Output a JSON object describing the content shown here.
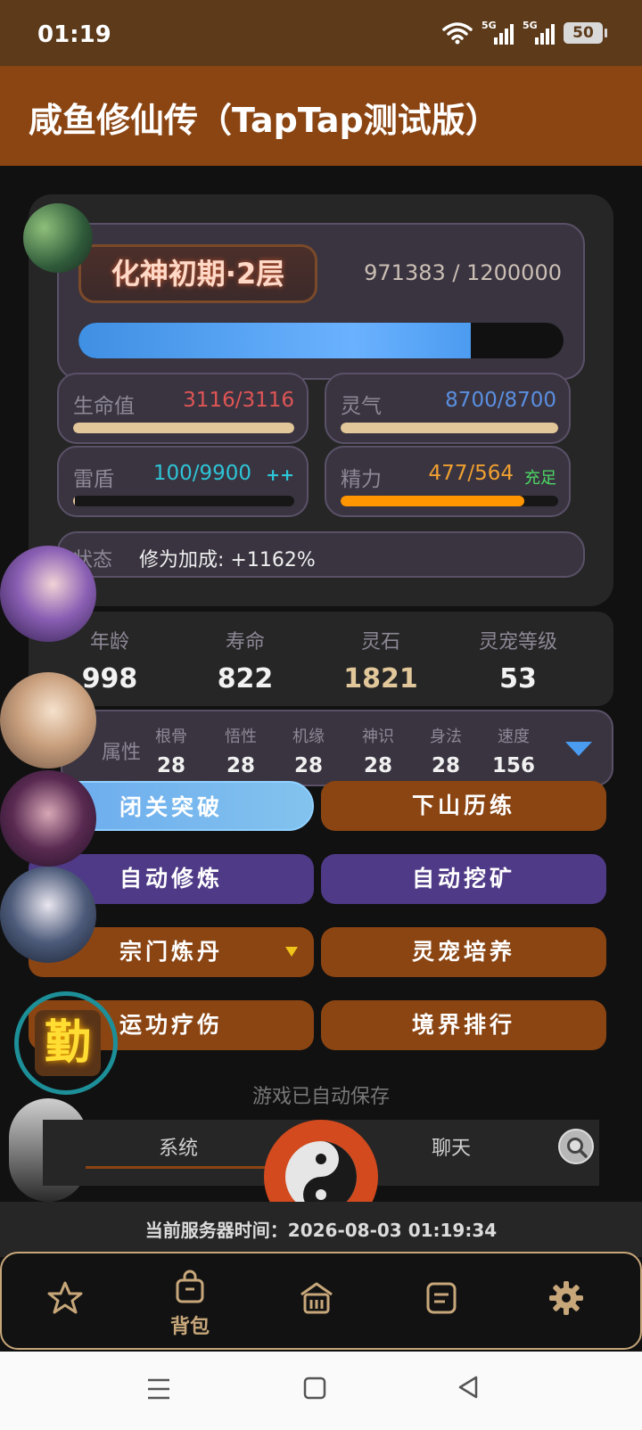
{
  "status_bar": {
    "time": "01:19",
    "signal1": "5G",
    "signal2": "5G",
    "battery": "50"
  },
  "title": "咸鱼修仙传（TapTap测试版）",
  "realm": {
    "name": "化神初期·2层",
    "xp_text": "971383 / 1200000",
    "xp_current": 971383,
    "xp_max": 1200000
  },
  "stats": {
    "hp": {
      "label": "生命值",
      "value": "3116/3116",
      "fraction": 1.0,
      "color": "#e05555"
    },
    "spirit": {
      "label": "灵气",
      "value": "8700/8700",
      "fraction": 1.0,
      "color": "#5a8fe0"
    },
    "shield": {
      "label": "雷盾",
      "value": "100/9900",
      "extra": "++",
      "fraction": 0.01,
      "color": "#2ec4d6"
    },
    "energy": {
      "label": "精力",
      "value": "477/564",
      "extra": "充足",
      "fraction": 0.845,
      "color": "#f0a030",
      "extra_color": "#4cd964"
    }
  },
  "state": {
    "label": "状态",
    "value": "修为加成: +1162%"
  },
  "info": [
    {
      "label": "年龄",
      "value": "998"
    },
    {
      "label": "寿命",
      "value": "822"
    },
    {
      "label": "灵石",
      "value": "1821"
    },
    {
      "label": "灵宠等级",
      "value": "53"
    }
  ],
  "attributes": {
    "title": "属性",
    "items": [
      {
        "label": "根骨",
        "value": "28"
      },
      {
        "label": "悟性",
        "value": "28"
      },
      {
        "label": "机缘",
        "value": "28"
      },
      {
        "label": "神识",
        "value": "28"
      },
      {
        "label": "身法",
        "value": "28"
      },
      {
        "label": "速度",
        "value": "156"
      }
    ]
  },
  "buttons": {
    "breakthrough": "闭关突破",
    "adventure": "下山历练",
    "auto_cultivate": "自动修炼",
    "auto_mine": "自动挖矿",
    "alchemy": "宗门炼丹",
    "pet_training": "灵宠培养",
    "heal": "运功疗伤",
    "ranking": "境界排行"
  },
  "diligence_badge": "勤",
  "save_notice": "游戏已自动保存",
  "tabs": {
    "system": "系统",
    "chat": "聊天"
  },
  "server_time": "当前服务器时间：2026-08-03 01:19:34",
  "bottom_nav": {
    "bag": "背包"
  },
  "icons": [
    "wifi-icon",
    "signal-icon",
    "battery-icon",
    "star-icon",
    "bag-icon",
    "home-icon",
    "note-icon",
    "gear-icon",
    "search-icon",
    "taiji-icon",
    "menu-icon",
    "square-icon",
    "back-icon",
    "triangle-down-icon"
  ]
}
